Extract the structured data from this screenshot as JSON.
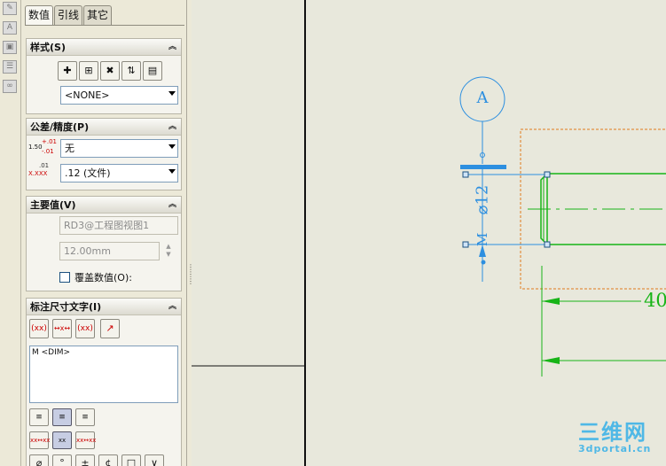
{
  "tabs": [
    "数值",
    "引线",
    "其它"
  ],
  "strip_icons": [
    "sketch-icon",
    "annotation-icon",
    "lock-icon",
    "layer-icon",
    "link-icon"
  ],
  "style": {
    "header": "样式(S)",
    "buttons": [
      "add-style-icon",
      "save-style-icon",
      "delete-style-icon",
      "update-style-icon",
      "load-style-icon"
    ],
    "select_value": "<NONE>"
  },
  "tolerance": {
    "header": "公差/精度(P)",
    "tol_value": "无",
    "tol_icon_text": "1.50",
    "tol_icon_sup": "+.01",
    "tol_icon_sub": "-.01",
    "prec_icon_sup": ".01",
    "prec_icon_text": "X.XXX",
    "prec_value": ".12 (文件)"
  },
  "primary": {
    "header": "主要值(V)",
    "ref_value": "RD3@工程图视图1",
    "dim_value": "12.00mm",
    "override_label": "覆盖数值(O):"
  },
  "dimtext": {
    "header": "标注尺寸文字(I)",
    "text_buttons": [
      "(xx)",
      "↔x↔",
      "(xx)",
      "↗"
    ],
    "text_content": "M <DIM>",
    "align_buttons": [
      "align-left-icon",
      "align-center-icon",
      "align-right-icon"
    ],
    "layout_buttons": [
      "xx↔xx",
      "xx",
      "xx↔xx"
    ],
    "symbol_buttons": [
      "⌀",
      "°",
      "±",
      "¢",
      "□",
      "∨"
    ]
  },
  "drawing": {
    "datum_label": "A",
    "dia_label": "⌀12",
    "m_label": "M",
    "dim_value": "40"
  },
  "watermark": {
    "big": "三维网",
    "small": "3dportal.cn"
  },
  "colors": {
    "canvas_bg": "#e8e8dc",
    "dim_blue": "#2d8fe0",
    "geometry_green": "#17b417",
    "view_border": "#e07a1c"
  }
}
